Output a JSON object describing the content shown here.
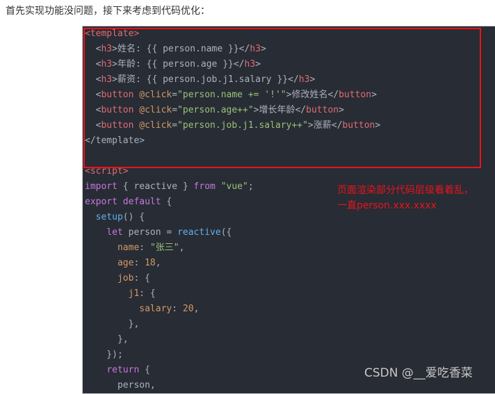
{
  "intro": "首先实现功能没问题，接下来考虑到代码优化：",
  "code": {
    "lines": [
      [
        {
          "c": "tag",
          "t": "<template>"
        }
      ],
      [
        {
          "c": "plain",
          "t": "  "
        },
        {
          "c": "punct",
          "t": "<"
        },
        {
          "c": "tag",
          "t": "h3"
        },
        {
          "c": "punct",
          "t": ">姓名: {{ person.name }}</"
        },
        {
          "c": "tag",
          "t": "h3"
        },
        {
          "c": "punct",
          "t": ">"
        }
      ],
      [
        {
          "c": "plain",
          "t": "  "
        },
        {
          "c": "punct",
          "t": "<"
        },
        {
          "c": "tag",
          "t": "h3"
        },
        {
          "c": "punct",
          "t": ">年龄: {{ person.age }}</"
        },
        {
          "c": "tag",
          "t": "h3"
        },
        {
          "c": "punct",
          "t": ">"
        }
      ],
      [
        {
          "c": "plain",
          "t": "  "
        },
        {
          "c": "punct",
          "t": "<"
        },
        {
          "c": "tag",
          "t": "h3"
        },
        {
          "c": "punct",
          "t": ">薪资: {{ person.job.j1.salary }}</"
        },
        {
          "c": "tag",
          "t": "h3"
        },
        {
          "c": "punct",
          "t": ">"
        }
      ],
      [
        {
          "c": "plain",
          "t": "  "
        },
        {
          "c": "punct",
          "t": "<"
        },
        {
          "c": "tag",
          "t": "button"
        },
        {
          "c": "plain",
          "t": " "
        },
        {
          "c": "attr",
          "t": "@click"
        },
        {
          "c": "punct",
          "t": "="
        },
        {
          "c": "str",
          "t": "\"person.name += '!'\""
        },
        {
          "c": "punct",
          "t": ">修改姓名</"
        },
        {
          "c": "tag",
          "t": "button"
        },
        {
          "c": "punct",
          "t": ">"
        }
      ],
      [
        {
          "c": "plain",
          "t": "  "
        },
        {
          "c": "punct",
          "t": "<"
        },
        {
          "c": "tag",
          "t": "button"
        },
        {
          "c": "plain",
          "t": " "
        },
        {
          "c": "attr",
          "t": "@click"
        },
        {
          "c": "punct",
          "t": "="
        },
        {
          "c": "str",
          "t": "\"person.age++\""
        },
        {
          "c": "punct",
          "t": ">增长年龄</"
        },
        {
          "c": "tag",
          "t": "button"
        },
        {
          "c": "punct",
          "t": ">"
        }
      ],
      [
        {
          "c": "plain",
          "t": "  "
        },
        {
          "c": "punct",
          "t": "<"
        },
        {
          "c": "tag",
          "t": "button"
        },
        {
          "c": "plain",
          "t": " "
        },
        {
          "c": "attr",
          "t": "@click"
        },
        {
          "c": "punct",
          "t": "="
        },
        {
          "c": "str",
          "t": "\"person.job.j1.salary++\""
        },
        {
          "c": "punct",
          "t": ">涨薪</"
        },
        {
          "c": "tag",
          "t": "button"
        },
        {
          "c": "punct",
          "t": ">"
        }
      ],
      [
        {
          "c": "punct",
          "t": "</"
        },
        {
          "c": "plain",
          "t": "template"
        },
        {
          "c": "punct",
          "t": ">"
        }
      ],
      [
        {
          "c": "plain",
          "t": ""
        }
      ],
      [
        {
          "c": "tag",
          "t": "<script>"
        }
      ],
      [
        {
          "c": "kw",
          "t": "import"
        },
        {
          "c": "plain",
          "t": " { reactive } "
        },
        {
          "c": "kw",
          "t": "from"
        },
        {
          "c": "plain",
          "t": " "
        },
        {
          "c": "str",
          "t": "\"vue\""
        },
        {
          "c": "plain",
          "t": ";"
        }
      ],
      [
        {
          "c": "kw",
          "t": "export"
        },
        {
          "c": "plain",
          "t": " "
        },
        {
          "c": "kw",
          "t": "default"
        },
        {
          "c": "plain",
          "t": " {"
        }
      ],
      [
        {
          "c": "plain",
          "t": "  "
        },
        {
          "c": "fn",
          "t": "setup"
        },
        {
          "c": "plain",
          "t": "() {"
        }
      ],
      [
        {
          "c": "plain",
          "t": "    "
        },
        {
          "c": "kw",
          "t": "let"
        },
        {
          "c": "plain",
          "t": " person = "
        },
        {
          "c": "fn",
          "t": "reactive"
        },
        {
          "c": "plain",
          "t": "({"
        }
      ],
      [
        {
          "c": "plain",
          "t": "      "
        },
        {
          "c": "prop",
          "t": "name"
        },
        {
          "c": "plain",
          "t": ": "
        },
        {
          "c": "str",
          "t": "\"张三\""
        },
        {
          "c": "plain",
          "t": ","
        }
      ],
      [
        {
          "c": "plain",
          "t": "      "
        },
        {
          "c": "prop",
          "t": "age"
        },
        {
          "c": "plain",
          "t": ": "
        },
        {
          "c": "num",
          "t": "18"
        },
        {
          "c": "plain",
          "t": ","
        }
      ],
      [
        {
          "c": "plain",
          "t": "      "
        },
        {
          "c": "prop",
          "t": "job"
        },
        {
          "c": "plain",
          "t": ": {"
        }
      ],
      [
        {
          "c": "plain",
          "t": "        "
        },
        {
          "c": "prop",
          "t": "j1"
        },
        {
          "c": "plain",
          "t": ": {"
        }
      ],
      [
        {
          "c": "plain",
          "t": "          "
        },
        {
          "c": "prop",
          "t": "salary"
        },
        {
          "c": "plain",
          "t": ": "
        },
        {
          "c": "num",
          "t": "20"
        },
        {
          "c": "plain",
          "t": ","
        }
      ],
      [
        {
          "c": "plain",
          "t": "        },"
        }
      ],
      [
        {
          "c": "plain",
          "t": "      },"
        }
      ],
      [
        {
          "c": "plain",
          "t": "    });"
        }
      ],
      [
        {
          "c": "plain",
          "t": "    "
        },
        {
          "c": "kw",
          "t": "return"
        },
        {
          "c": "plain",
          "t": " {"
        }
      ],
      [
        {
          "c": "plain",
          "t": "      person,"
        }
      ]
    ]
  },
  "annotation": {
    "line1": "页面渲染部分代码层级看着乱，",
    "line2": "一直person.xxx.xxxx"
  },
  "watermark": "CSDN @__爱吃香菜",
  "colors": {
    "highlight": "#e8141c",
    "code_bg": "#282c34"
  }
}
